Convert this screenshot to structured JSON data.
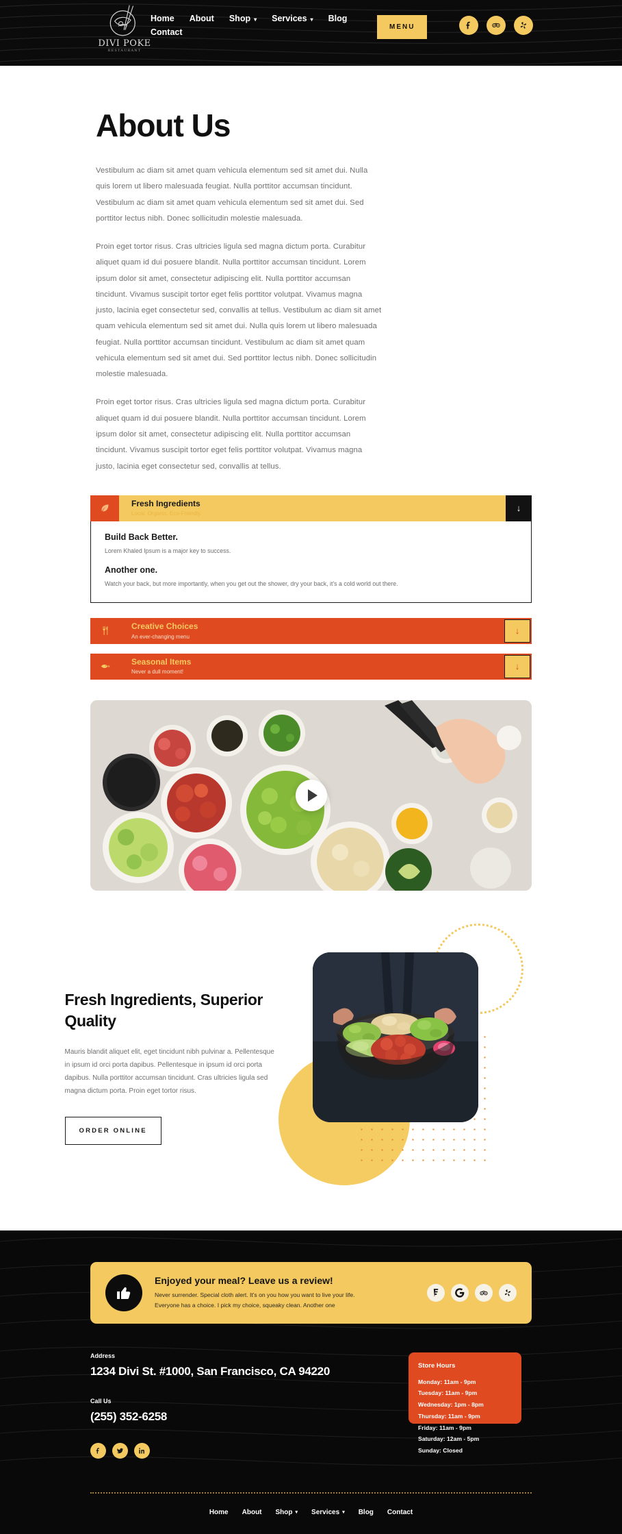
{
  "brand": {
    "name": "DIVI POKE",
    "tagline": "RESTAURANT",
    "logo_icon": "poke-bowl-chopsticks-logo"
  },
  "header": {
    "nav": [
      {
        "label": "Home",
        "has_dropdown": false
      },
      {
        "label": "About",
        "has_dropdown": false
      },
      {
        "label": "Shop",
        "has_dropdown": true
      },
      {
        "label": "Services",
        "has_dropdown": true
      },
      {
        "label": "Blog",
        "has_dropdown": false
      },
      {
        "label": "Contact",
        "has_dropdown": false
      }
    ],
    "menu_button": "MENU",
    "social": [
      {
        "name": "facebook-icon"
      },
      {
        "name": "tripadvisor-icon"
      },
      {
        "name": "yelp-icon"
      }
    ],
    "colors": {
      "background": "#0b0b0b",
      "accent": "#f3c960"
    }
  },
  "about": {
    "title": "About Us",
    "paragraphs": [
      "Vestibulum ac diam sit amet quam vehicula elementum sed sit amet dui. Nulla quis lorem ut libero malesuada feugiat. Nulla porttitor accumsan tincidunt. Vestibulum ac diam sit amet quam vehicula elementum sed sit amet dui. Sed porttitor lectus nibh. Donec sollicitudin molestie malesuada.",
      "Proin eget tortor risus. Cras ultricies ligula sed magna dictum porta. Curabitur aliquet quam id dui posuere blandit. Nulla porttitor accumsan tincidunt. Lorem ipsum dolor sit amet, consectetur adipiscing elit. Nulla porttitor accumsan tincidunt. Vivamus suscipit tortor eget felis porttitor volutpat. Vivamus magna justo, lacinia eget consectetur sed, convallis at tellus. Vestibulum ac diam sit amet quam vehicula elementum sed sit amet dui. Nulla quis lorem ut libero malesuada feugiat. Nulla porttitor accumsan tincidunt. Vestibulum ac diam sit amet quam vehicula elementum sed sit amet dui. Sed porttitor lectus nibh. Donec sollicitudin molestie malesuada.",
      "Proin eget tortor risus. Cras ultricies ligula sed magna dictum porta. Curabitur aliquet quam id dui posuere blandit. Nulla porttitor accumsan tincidunt. Lorem ipsum dolor sit amet, consectetur adipiscing elit. Nulla porttitor accumsan tincidunt. Vivamus suscipit tortor eget felis porttitor volutpat. Vivamus magna justo, lacinia eget consectetur sed, convallis at tellus."
    ]
  },
  "accordion": [
    {
      "title": "Fresh Ingredients",
      "subtitle": "Local. Organic. Eco-Friendly.",
      "icon": "leaf-icon",
      "toggle": "↓",
      "state": "open",
      "body": {
        "heading1": "Build Back Better.",
        "text1": "Lorem Khaled Ipsum is a major key to success.",
        "heading2": "Another one.",
        "text2": "Watch your back, but more importantly, when you get out the shower, dry your back, it's a cold world out there."
      }
    },
    {
      "title": "Creative Choices",
      "subtitle": "An ever-changing menu",
      "icon": "fork-knife-icon",
      "toggle": "↓",
      "state": "closed"
    },
    {
      "title": "Seasonal Items",
      "subtitle": "Never a dull moment!",
      "icon": "fish-icon",
      "toggle": "↓",
      "state": "closed"
    }
  ],
  "video": {
    "play_icon": "play-button-icon",
    "alt": "Overhead photo of poke bowl ingredients: edamame, cucumber, radish, salmon, rice, avocado, soy sauce"
  },
  "feature": {
    "heading": "Fresh Ingredients, Superior Quality",
    "paragraph": "Mauris blandit aliquet elit, eget tincidunt nibh pulvinar a. Pellentesque in ipsum id orci porta dapibus. Pellentesque in ipsum id orci porta dapibus. Nulla porttitor accumsan tincidunt. Cras ultricies ligula sed magna dictum porta. Proin eget tortor risus.",
    "button": "ORDER ONLINE",
    "image_alt": "Hands holding a dark bowl of poke with salmon, edamame, avocado and rice",
    "decor": {
      "ring_color": "#f3c960",
      "circle_color": "#f5cc62",
      "dots_color": "#e68a2b"
    }
  },
  "footer": {
    "review": {
      "icon": "thumbs-up-icon",
      "heading": "Enjoyed your meal? Leave us a review!",
      "line1": "Never surrender. Special cloth alert. It's on you how you want to live your life.",
      "line2": "Everyone has a choice. I pick my choice, squeaky clean. Another one",
      "social": [
        {
          "name": "foursquare-icon"
        },
        {
          "name": "google-icon"
        },
        {
          "name": "tripadvisor-icon"
        },
        {
          "name": "yelp-icon"
        }
      ]
    },
    "address_label": "Address",
    "address_value": "1234 Divi St. #1000, San Francisco, CA 94220",
    "phone_label": "Call Us",
    "phone_value": "(255) 352-6258",
    "social": [
      {
        "name": "facebook-icon"
      },
      {
        "name": "twitter-icon"
      },
      {
        "name": "linkedin-icon"
      }
    ],
    "hours": {
      "title": "Store Hours",
      "items": [
        "Monday: 11am - 9pm",
        "Tuesday: 11am - 9pm",
        "Wednesday: 1pm - 8pm",
        "Thursday: 11am - 9pm",
        "Friday: 11am - 9pm",
        "Saturday: 12am - 5pm",
        "Sunday: Closed"
      ]
    },
    "nav": [
      {
        "label": "Home",
        "has_dropdown": false
      },
      {
        "label": "About",
        "has_dropdown": false
      },
      {
        "label": "Shop",
        "has_dropdown": true
      },
      {
        "label": "Services",
        "has_dropdown": true
      },
      {
        "label": "Blog",
        "has_dropdown": false
      },
      {
        "label": "Contact",
        "has_dropdown": false
      }
    ]
  }
}
